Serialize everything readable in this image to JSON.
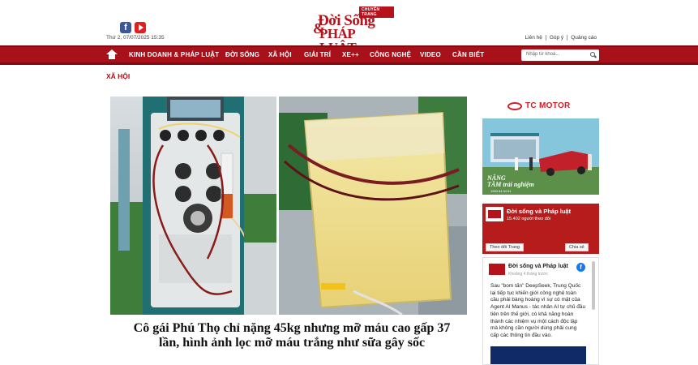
{
  "header": {
    "datetime": "Thứ 2, 07/07/2025 15:35",
    "logo": {
      "badge": "CHUYÊN TRANG",
      "line1": "Đời Sống",
      "amp": "&",
      "line2": "PHÁP LUẬT"
    },
    "links": [
      "Liên hệ",
      "Góp ý",
      "Quảng cáo"
    ],
    "social": [
      {
        "icon": "facebook-icon"
      },
      {
        "icon": "youtube-icon"
      }
    ]
  },
  "nav": {
    "items": [
      "KINH DOANH & PHÁP LUẬT",
      "ĐỜI SỐNG",
      "XÃ HỘI",
      "GIẢI TRÍ",
      "XE++",
      "CÔNG NGHỆ",
      "VIDEO",
      "CẦN BIẾT"
    ],
    "search_placeholder": "Nhập từ khoá..."
  },
  "section": "XÃ HỘI",
  "article": {
    "headline": "Cô gái Phú Thọ chỉ nặng 45kg nhưng mỡ máu cao gấp 37 lần, hình ảnh lọc mỡ máu trắng như sữa gây sốc"
  },
  "sidebar": {
    "ad": {
      "brand": "TC MOTOR",
      "tagline_1": "NÂNG",
      "tagline_2": "TẦM trải nghiệm",
      "phone": "1900.54.54.51"
    },
    "fb_page": {
      "name": "Đời sống và Pháp luật",
      "followers": "15.402 người theo dõi",
      "follow_label": "Theo dõi Trang",
      "share_label": "Chia sẻ"
    },
    "fb_feed": {
      "name": "Đời sống và Pháp luật",
      "time": "Khoảng 4 tháng trước",
      "text": "Sau \"bom tấn\" DeepSeek, Trung Quốc lại tiếp tục khiến giới công nghệ toàn cầu phải bàng hoàng vì sự có mặt của Agent AI Manus - tác nhân AI tự chủ đầu tiên trên thế giới, có khả năng hoàn thành các nhiệm vụ một cách độc lập mà không cần người dùng phải cung cấp các thông tin đầu vào."
    }
  },
  "colors": {
    "brand_red": "#a8101a",
    "text_dark": "#111111"
  }
}
